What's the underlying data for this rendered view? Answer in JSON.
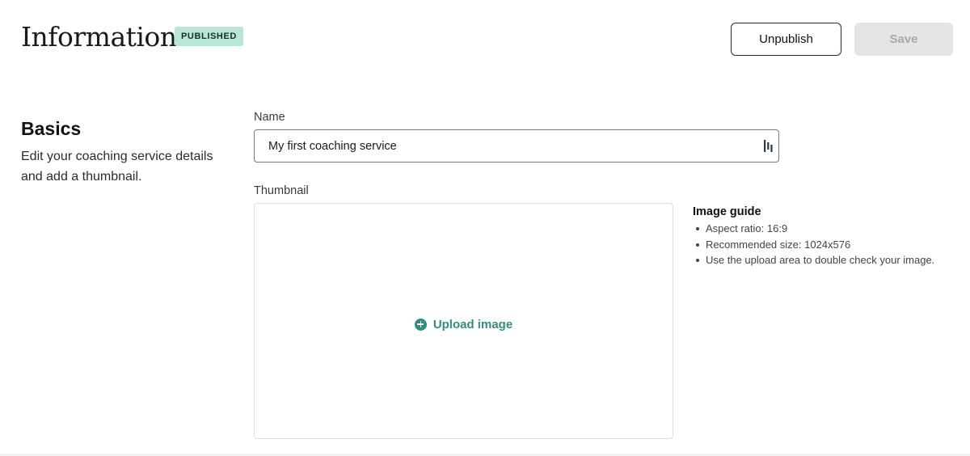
{
  "header": {
    "title": "Information",
    "status_badge": "PUBLISHED",
    "unpublish_label": "Unpublish",
    "save_label": "Save"
  },
  "basics": {
    "title": "Basics",
    "description": "Edit your coaching service details and add a thumbnail."
  },
  "name_field": {
    "label": "Name",
    "value": "My first coaching service"
  },
  "thumbnail": {
    "label": "Thumbnail",
    "upload_label": "Upload image"
  },
  "image_guide": {
    "title": "Image guide",
    "items": [
      "Aspect ratio: 16:9",
      "Recommended size: 1024x576",
      "Use the upload area to double check your image."
    ]
  },
  "colors": {
    "accent": "#2f8f7c",
    "badge_bg": "#b9e7d7",
    "disabled_bg": "#e5e5e5"
  }
}
